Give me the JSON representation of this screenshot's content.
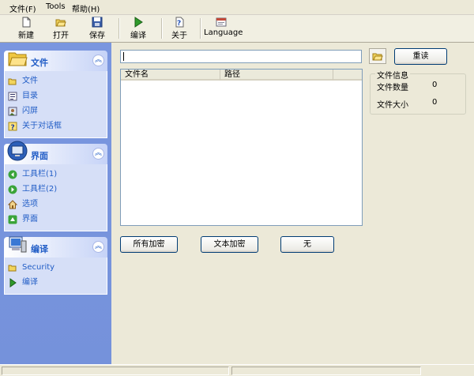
{
  "menu": {
    "items": [
      {
        "label": "文件(F)"
      },
      {
        "label": "Tools"
      },
      {
        "label": "帮助(H)"
      }
    ]
  },
  "toolbar": {
    "buttons": [
      {
        "label": "新建",
        "icon": "new-file-icon"
      },
      {
        "label": "打开",
        "icon": "open-folder-icon"
      },
      {
        "label": "保存",
        "icon": "save-disk-icon"
      },
      {
        "label": "编译",
        "icon": "play-icon"
      },
      {
        "label": "关于",
        "icon": "help-icon"
      },
      {
        "label": "Language",
        "icon": "language-window-icon"
      }
    ]
  },
  "sidebar": {
    "panels": [
      {
        "title": "文件",
        "icon": "folder-icon",
        "items": [
          {
            "label": "文件",
            "icon": "open-folder-icon"
          },
          {
            "label": "目录",
            "icon": "list-icon"
          },
          {
            "label": "闪屏",
            "icon": "image-icon"
          },
          {
            "label": "关于对话框",
            "icon": "help-icon"
          }
        ]
      },
      {
        "title": "界面",
        "icon": "monitor-icon",
        "items": [
          {
            "label": "工具栏(1)",
            "icon": "green-arrow-left-icon"
          },
          {
            "label": "工具栏(2)",
            "icon": "green-arrow-right-icon"
          },
          {
            "label": "选项",
            "icon": "house-icon"
          },
          {
            "label": "界面",
            "icon": "green-arrow-up-icon"
          }
        ]
      },
      {
        "title": "编译",
        "icon": "computer-icon",
        "items": [
          {
            "label": "Security",
            "icon": "open-folder-icon"
          },
          {
            "label": "编译",
            "icon": "play-icon"
          }
        ]
      }
    ]
  },
  "main": {
    "path_value": "",
    "reload_label": "重读",
    "filelist_headers": [
      "文件名",
      "路径",
      ""
    ],
    "fileinfo": {
      "legend": "文件信息",
      "count_label": "文件数量",
      "count_value": "0",
      "size_label": "文件大小",
      "size_value": "0"
    },
    "buttons": [
      "所有加密",
      "文本加密",
      "无"
    ]
  },
  "colors": {
    "sidebar_bg": "#7a96df",
    "panel_title": "#215dc6",
    "window_bg": "#ece9d8"
  }
}
